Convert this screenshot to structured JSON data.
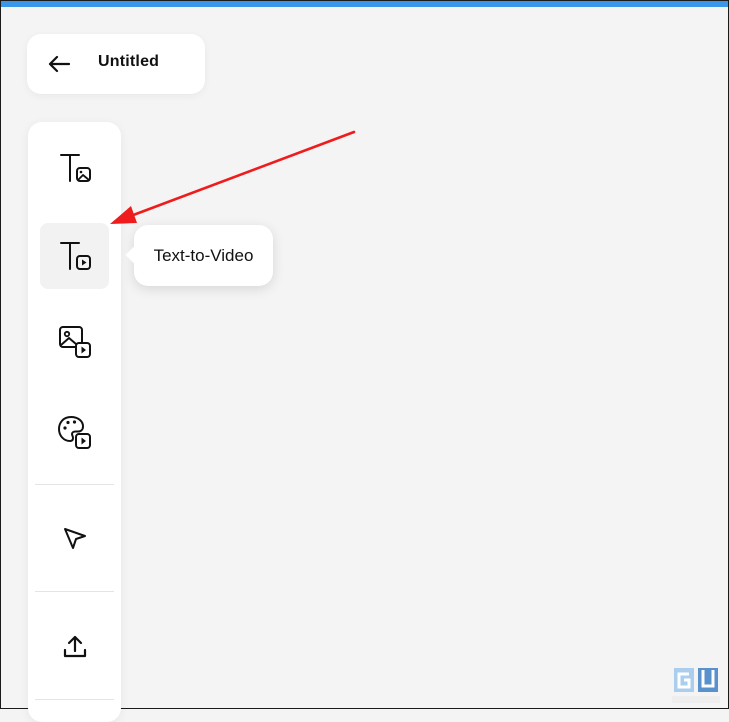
{
  "header": {
    "back_icon": "arrow-left-icon",
    "title": "Untitled"
  },
  "toolbar": {
    "items": [
      {
        "id": "text-to-image",
        "icon": "text-image-icon",
        "active": false
      },
      {
        "id": "text-to-video",
        "icon": "text-video-icon",
        "active": true
      },
      {
        "id": "image-to-video",
        "icon": "image-video-icon",
        "active": false
      },
      {
        "id": "style-to-video",
        "icon": "palette-video-icon",
        "active": false
      },
      {
        "id": "select",
        "icon": "cursor-arrow-icon",
        "active": false
      },
      {
        "id": "upload",
        "icon": "upload-icon",
        "active": false
      }
    ]
  },
  "tooltip": {
    "label": "Text-to-Video"
  },
  "annotation": {
    "color": "#ee1c1c"
  },
  "colors": {
    "top_accent": "#3a96e8",
    "background": "#f4f4f4"
  }
}
